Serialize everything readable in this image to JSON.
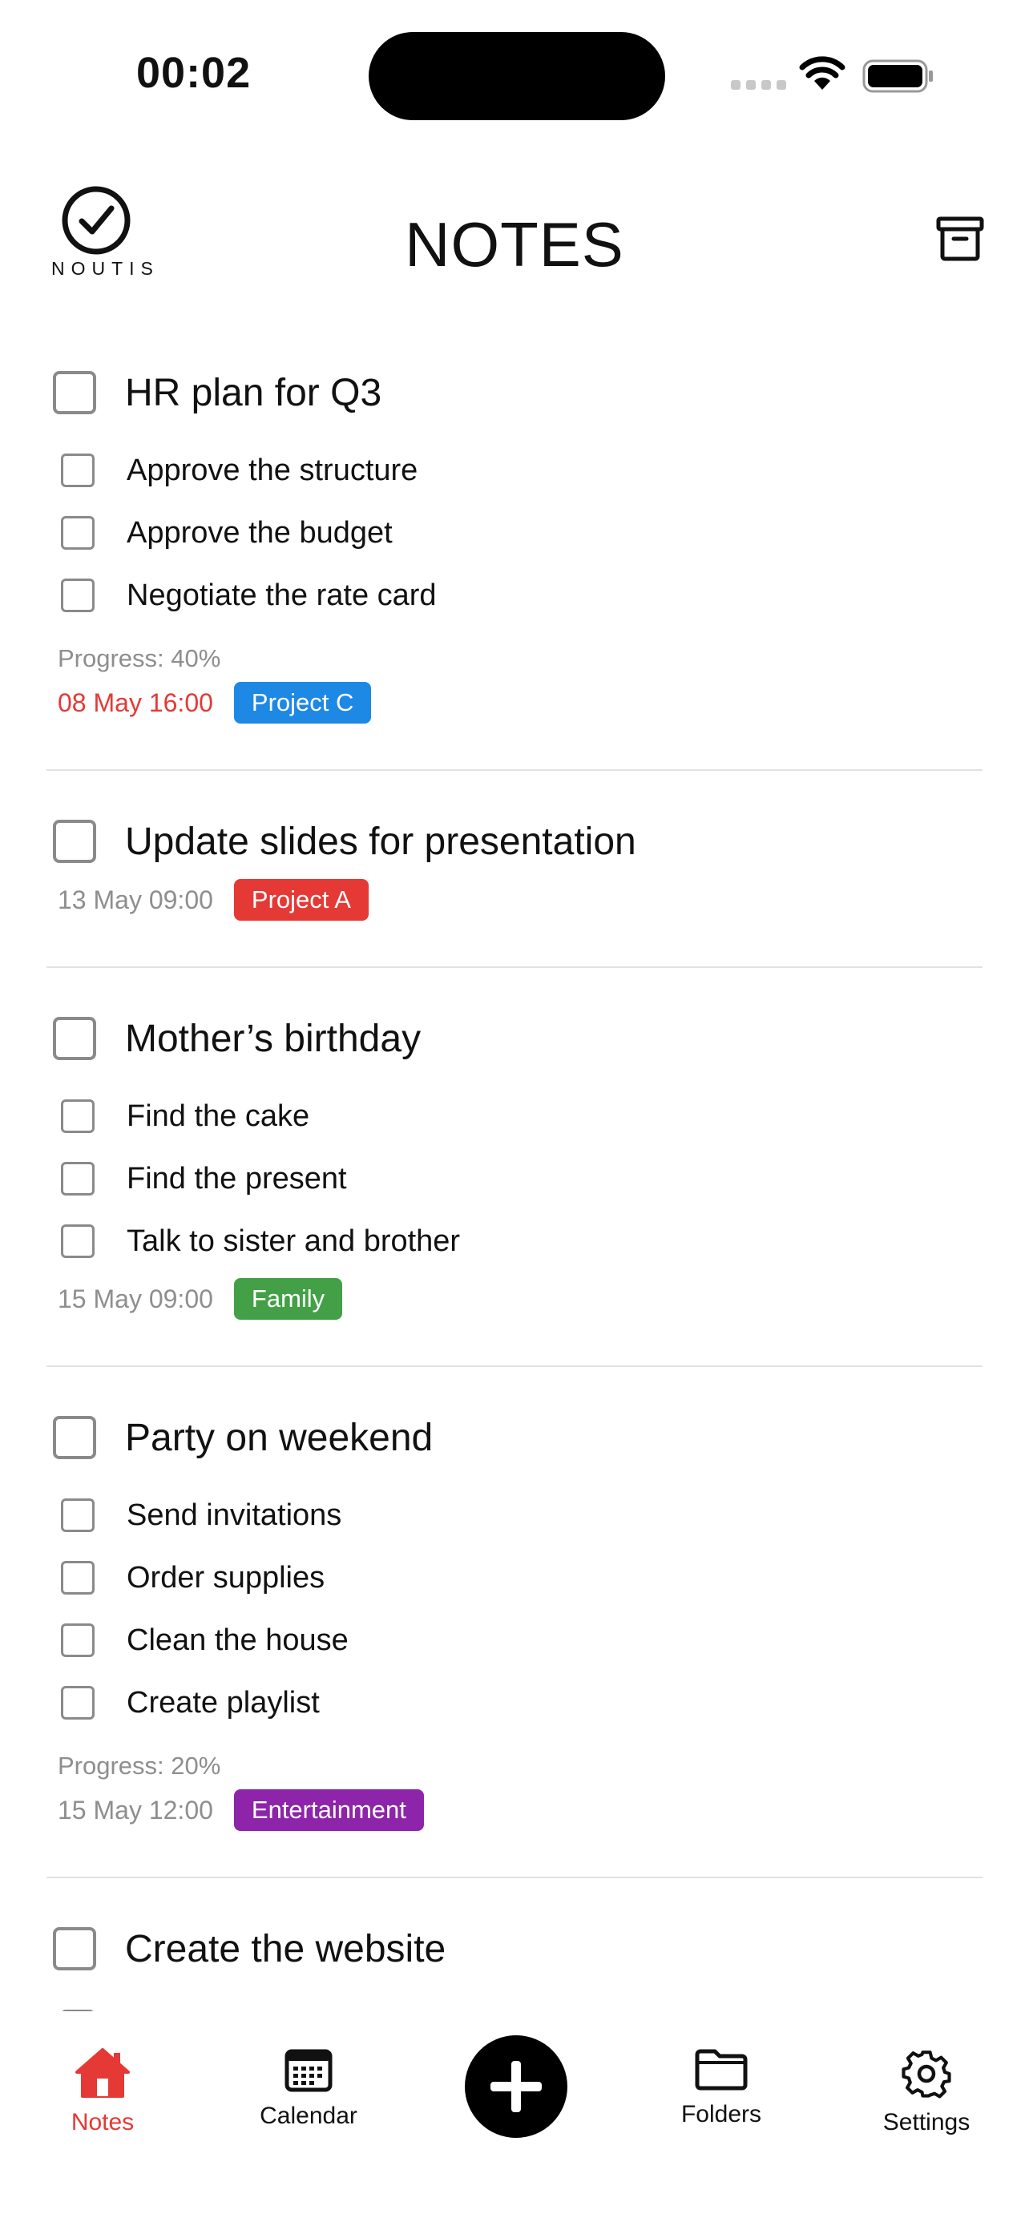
{
  "status_bar": {
    "time": "00:02"
  },
  "header": {
    "logo_text": "NOUTIS",
    "title": "NOTES"
  },
  "notes": [
    {
      "title": "HR plan for Q3",
      "items": [
        "Approve the structure",
        "Approve the budget",
        "Negotiate the rate card"
      ],
      "progress": "Progress: 40%",
      "date": "08 May 16:00",
      "date_overdue": true,
      "tag": {
        "label": "Project C",
        "color": "#1e88e5"
      }
    },
    {
      "title": "Update slides for presentation",
      "items": [],
      "date": "13 May 09:00",
      "tag": {
        "label": "Project A",
        "color": "#e53935"
      }
    },
    {
      "title": "Mother’s birthday",
      "items": [
        "Find the cake",
        "Find the present",
        "Talk to sister and brother"
      ],
      "date": "15 May 09:00",
      "tag": {
        "label": "Family",
        "color": "#43a047"
      }
    },
    {
      "title": "Party on weekend",
      "items": [
        "Send invitations",
        "Order supplies",
        "Clean the house",
        "Create playlist"
      ],
      "progress": "Progress: 20%",
      "date": "15 May 12:00",
      "tag": {
        "label": "Entertainment",
        "color": "#8e24aa"
      }
    },
    {
      "title": "Create the website",
      "items": []
    }
  ],
  "tabbar": {
    "notes": "Notes",
    "calendar": "Calendar",
    "folders": "Folders",
    "settings": "Settings"
  },
  "colors": {
    "accent": "#e53935",
    "text": "#111111",
    "muted": "#8e8e8e"
  },
  "icons": [
    "checkmark-circle-icon",
    "archive-icon",
    "home-icon",
    "calendar-icon",
    "plus-icon",
    "folder-icon",
    "gear-icon",
    "wifi-icon",
    "battery-icon"
  ]
}
